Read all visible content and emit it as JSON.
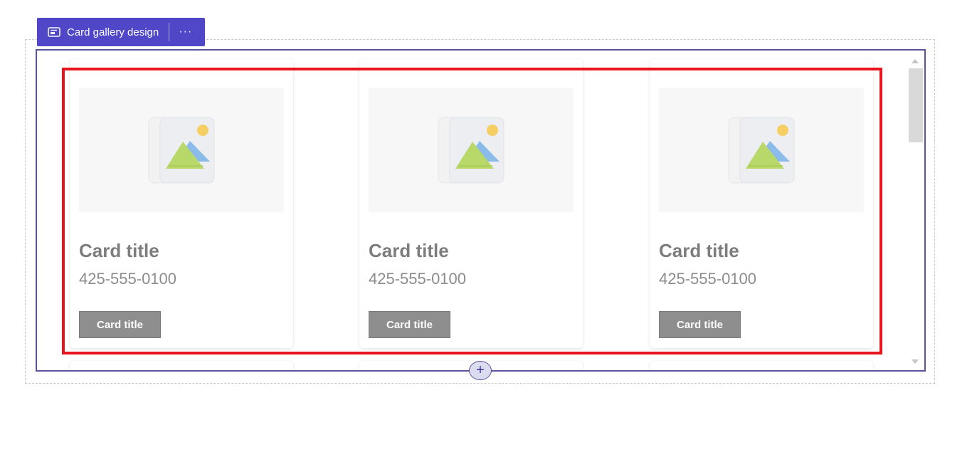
{
  "toolbar": {
    "title": "Card gallery design",
    "icon": "card-gallery-icon",
    "more_label": "···"
  },
  "cards": [
    {
      "title": "Card title",
      "phone": "425-555-0100",
      "button_label": "Card title",
      "image_icon": "image-placeholder-icon"
    },
    {
      "title": "Card title",
      "phone": "425-555-0100",
      "button_label": "Card title",
      "image_icon": "image-placeholder-icon"
    },
    {
      "title": "Card title",
      "phone": "425-555-0100",
      "button_label": "Card title",
      "image_icon": "image-placeholder-icon"
    }
  ],
  "add_button": {
    "label": "+"
  },
  "colors": {
    "toolbar_bg": "#4f46c8",
    "frame_border": "#5b559e",
    "selection_border": "#e8141e",
    "card_button": "#8e8e8e"
  }
}
